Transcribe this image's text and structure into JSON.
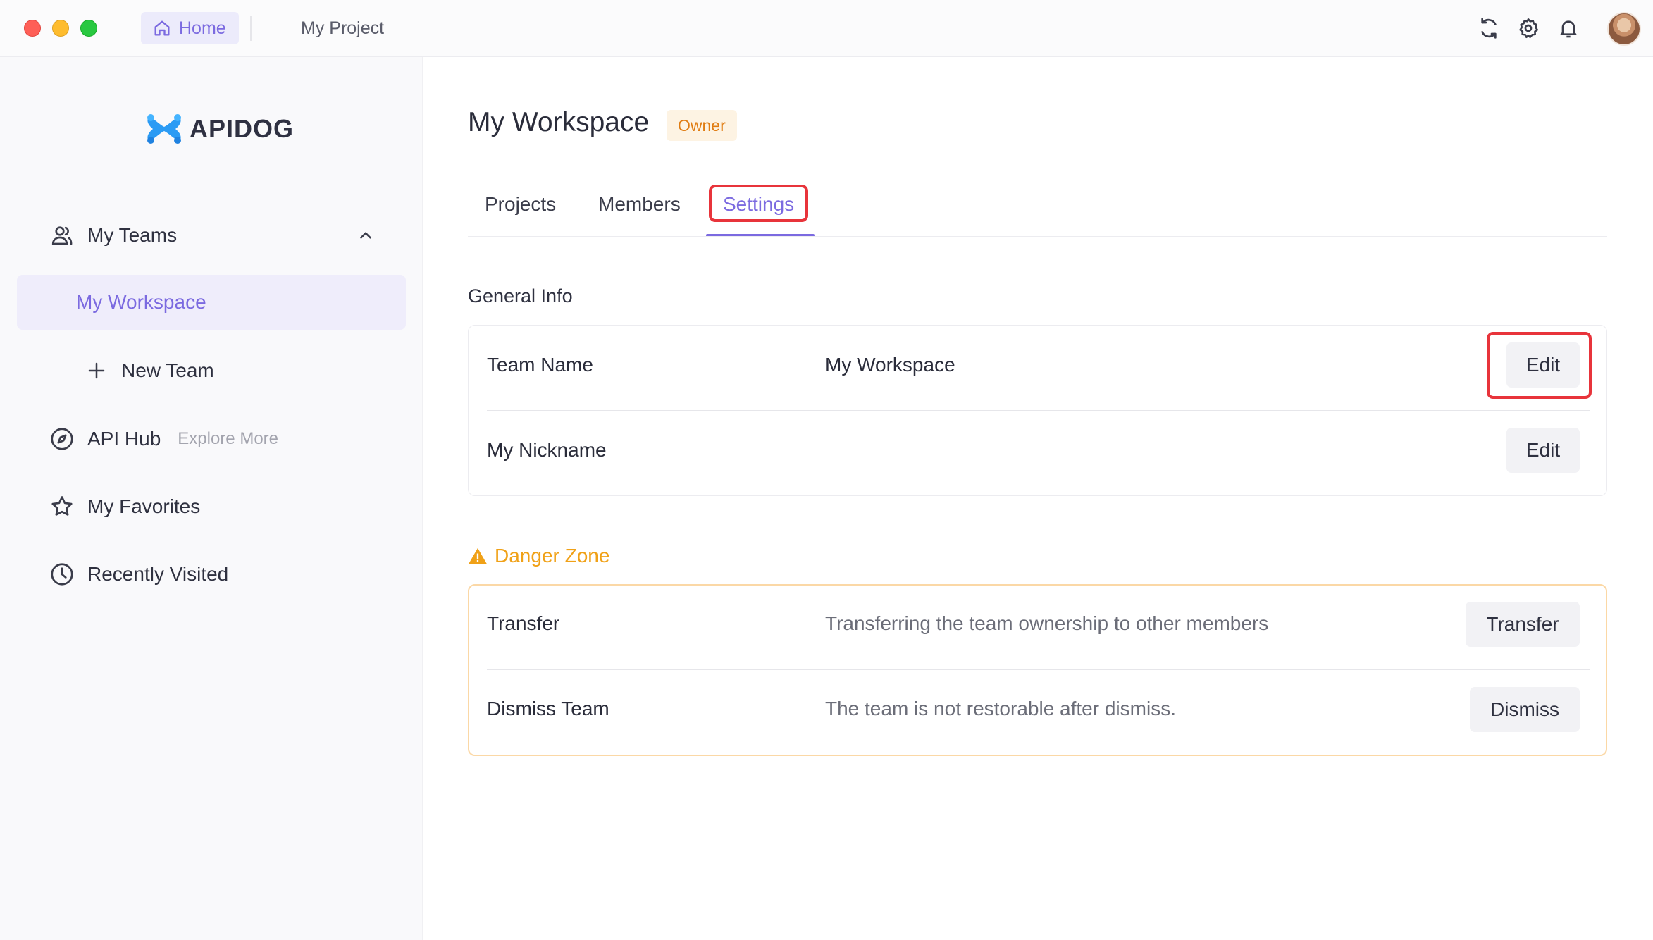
{
  "titlebar": {
    "home_label": "Home",
    "project_label": "My Project"
  },
  "sidebar": {
    "logo_text": "APIDOG",
    "my_teams": "My Teams",
    "selected_team": "My Workspace",
    "new_team": "New Team",
    "api_hub": "API Hub",
    "explore_more": "Explore More",
    "my_favorites": "My Favorites",
    "recently_visited": "Recently Visited"
  },
  "main": {
    "title": "My Workspace",
    "role_badge": "Owner",
    "tabs": [
      {
        "label": "Projects"
      },
      {
        "label": "Members"
      },
      {
        "label": "Settings"
      }
    ],
    "active_tab": "Settings",
    "general_info": {
      "title": "General Info",
      "rows": [
        {
          "label": "Team Name",
          "value": "My Workspace",
          "button": "Edit"
        },
        {
          "label": "My Nickname",
          "value": "",
          "button": "Edit"
        }
      ]
    },
    "danger_zone": {
      "title": "Danger Zone",
      "rows": [
        {
          "label": "Transfer",
          "description": "Transferring the team ownership to other members",
          "button": "Transfer"
        },
        {
          "label": "Dismiss Team",
          "description": "The team is not restorable after dismiss.",
          "button": "Dismiss"
        }
      ]
    }
  },
  "colors": {
    "accent": "#7b6ae0",
    "warning": "#f0a117",
    "badge_text": "#e07c12",
    "highlight_outline": "#e8343b"
  }
}
